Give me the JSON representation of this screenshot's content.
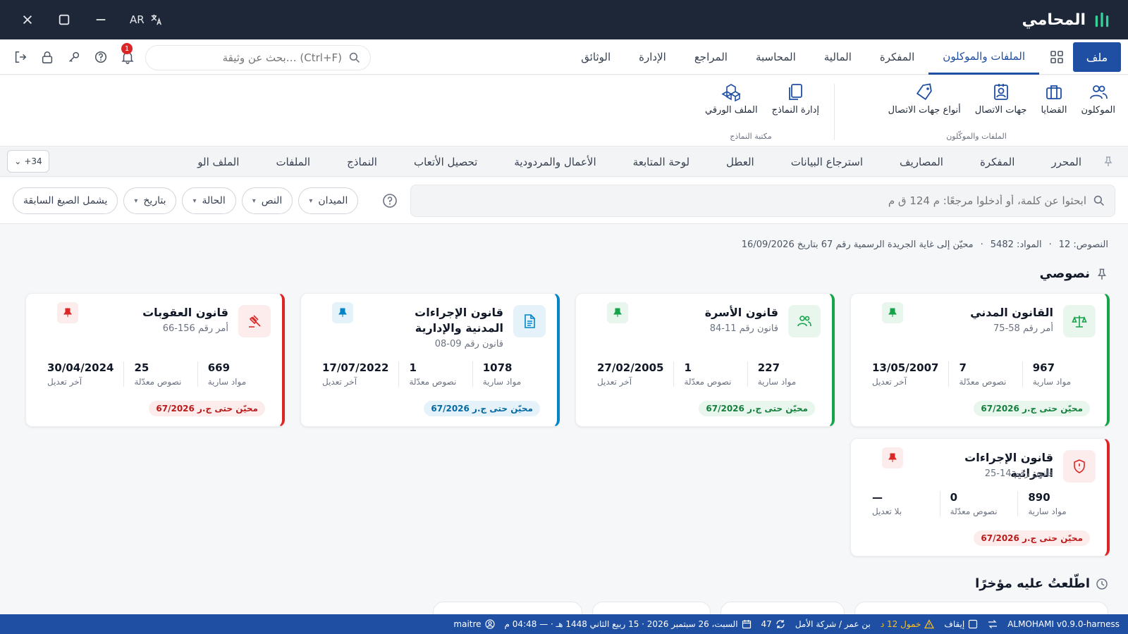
{
  "window": {
    "title": "المحامي",
    "lang_label": "AR"
  },
  "menu": {
    "file_label": "ملف",
    "tabs": [
      {
        "label": "الملفات والموكلون",
        "active": true
      },
      {
        "label": "المفكرة"
      },
      {
        "label": "المالية"
      },
      {
        "label": "المحاسبة"
      },
      {
        "label": "المراجع"
      },
      {
        "label": "الإدارة"
      },
      {
        "label": "الوثائق"
      }
    ],
    "search_placeholder": "بحث عن وثيقة… (Ctrl+F)",
    "notifications_count": "1"
  },
  "ribbon": {
    "groups": [
      {
        "label": "الملفات والموكّلون",
        "items": [
          {
            "label": "الموكلون",
            "icon": "users-icon"
          },
          {
            "label": "القضايا",
            "icon": "briefcase-icon"
          },
          {
            "label": "جهات الاتصال",
            "icon": "contact-card-icon"
          },
          {
            "label": "أنواع جهات الاتصال",
            "icon": "tag-icon"
          }
        ]
      },
      {
        "label": "مكتبة النماذج",
        "items": [
          {
            "label": "إدارة النماذج",
            "icon": "copy-icon"
          },
          {
            "label": "الملف الورقي",
            "icon": "boxes-icon"
          }
        ]
      }
    ]
  },
  "subtabs": {
    "items": [
      "المحرر",
      "المفكرة",
      "المصاريف",
      "استرجاع البيانات",
      "العطل",
      "لوحة المتابعة",
      "الأعمال والمردودية",
      "تحصيل الأتعاب",
      "النماذج",
      "الملفات",
      "الملف الو"
    ],
    "more_label": "+34"
  },
  "filters": {
    "search_placeholder": "ابحثوا عن كلمة، أو أدخلوا مرجعًا: م 124 ق م",
    "chips": [
      {
        "label": "الميدان"
      },
      {
        "label": "النص"
      },
      {
        "label": "الحالة"
      },
      {
        "label": "بتاريخ"
      },
      {
        "label": "يشمل الصيغ السابقة"
      }
    ]
  },
  "stats": {
    "texts": "النصوص: 12",
    "articles": "المواد: 5482",
    "updated": "محيّن إلى غاية الجريدة الرسمية رقم 67 بتاريخ 16/09/2026"
  },
  "my_texts": {
    "heading": "نصوصي",
    "cards": [
      {
        "title": "القانون المدني",
        "subtitle": "أمر رقم 58-75",
        "articles": "967",
        "articles_label": "مواد سارية",
        "amended": "7",
        "amended_label": "نصوص معدّلة",
        "last": "13/05/2007",
        "last_label": "آخر تعديل",
        "badge": "محيّن حتى ج.ر 67/2026",
        "accent": "#16a34a"
      },
      {
        "title": "قانون الأسرة",
        "subtitle": "قانون رقم 11-84",
        "articles": "227",
        "articles_label": "مواد سارية",
        "amended": "1",
        "amended_label": "نصوص معدّلة",
        "last": "27/02/2005",
        "last_label": "آخر تعديل",
        "badge": "محيّن حتى ج.ر 67/2026",
        "accent": "#16a34a"
      },
      {
        "title": "قانون الإجراءات المدنية والإدارية",
        "subtitle": "قانون رقم 09-08",
        "articles": "1078",
        "articles_label": "مواد سارية",
        "amended": "1",
        "amended_label": "نصوص معدّلة",
        "last": "17/07/2022",
        "last_label": "آخر تعديل",
        "badge": "محيّن حتى ج.ر 67/2026",
        "accent": "#0284c7"
      },
      {
        "title": "قانون العقوبات",
        "subtitle": "أمر رقم 156-66",
        "articles": "669",
        "articles_label": "مواد سارية",
        "amended": "25",
        "amended_label": "نصوص معدّلة",
        "last": "30/04/2024",
        "last_label": "آخر تعديل",
        "badge": "محيّن حتى ج.ر 67/2026",
        "accent": "#dc2626"
      },
      {
        "title": "قانون الإجراءات الجزائية",
        "subtitle": "قانون رقم 14-25",
        "articles": "890",
        "articles_label": "مواد سارية",
        "amended": "0",
        "amended_label": "نصوص معدّلة",
        "last": "—",
        "last_label": "بلا تعديل",
        "badge": "محيّن حتى ج.ر 67/2026",
        "accent": "#dc2626"
      }
    ]
  },
  "recent": {
    "heading": "اطّلعتُ عليه مؤخرًا"
  },
  "statusbar": {
    "user": "maitre",
    "date": "السبت، 26 سبتمبر 2026 · 15 ربيع الثاني 1448 هـ · — 04:48 م",
    "location": "بن عمر / شركة الأمل",
    "sync": "47",
    "idle": "خمول 12 د",
    "pause": "إيقاف",
    "version": "ALMOHAMI v0.9.0-harness"
  }
}
